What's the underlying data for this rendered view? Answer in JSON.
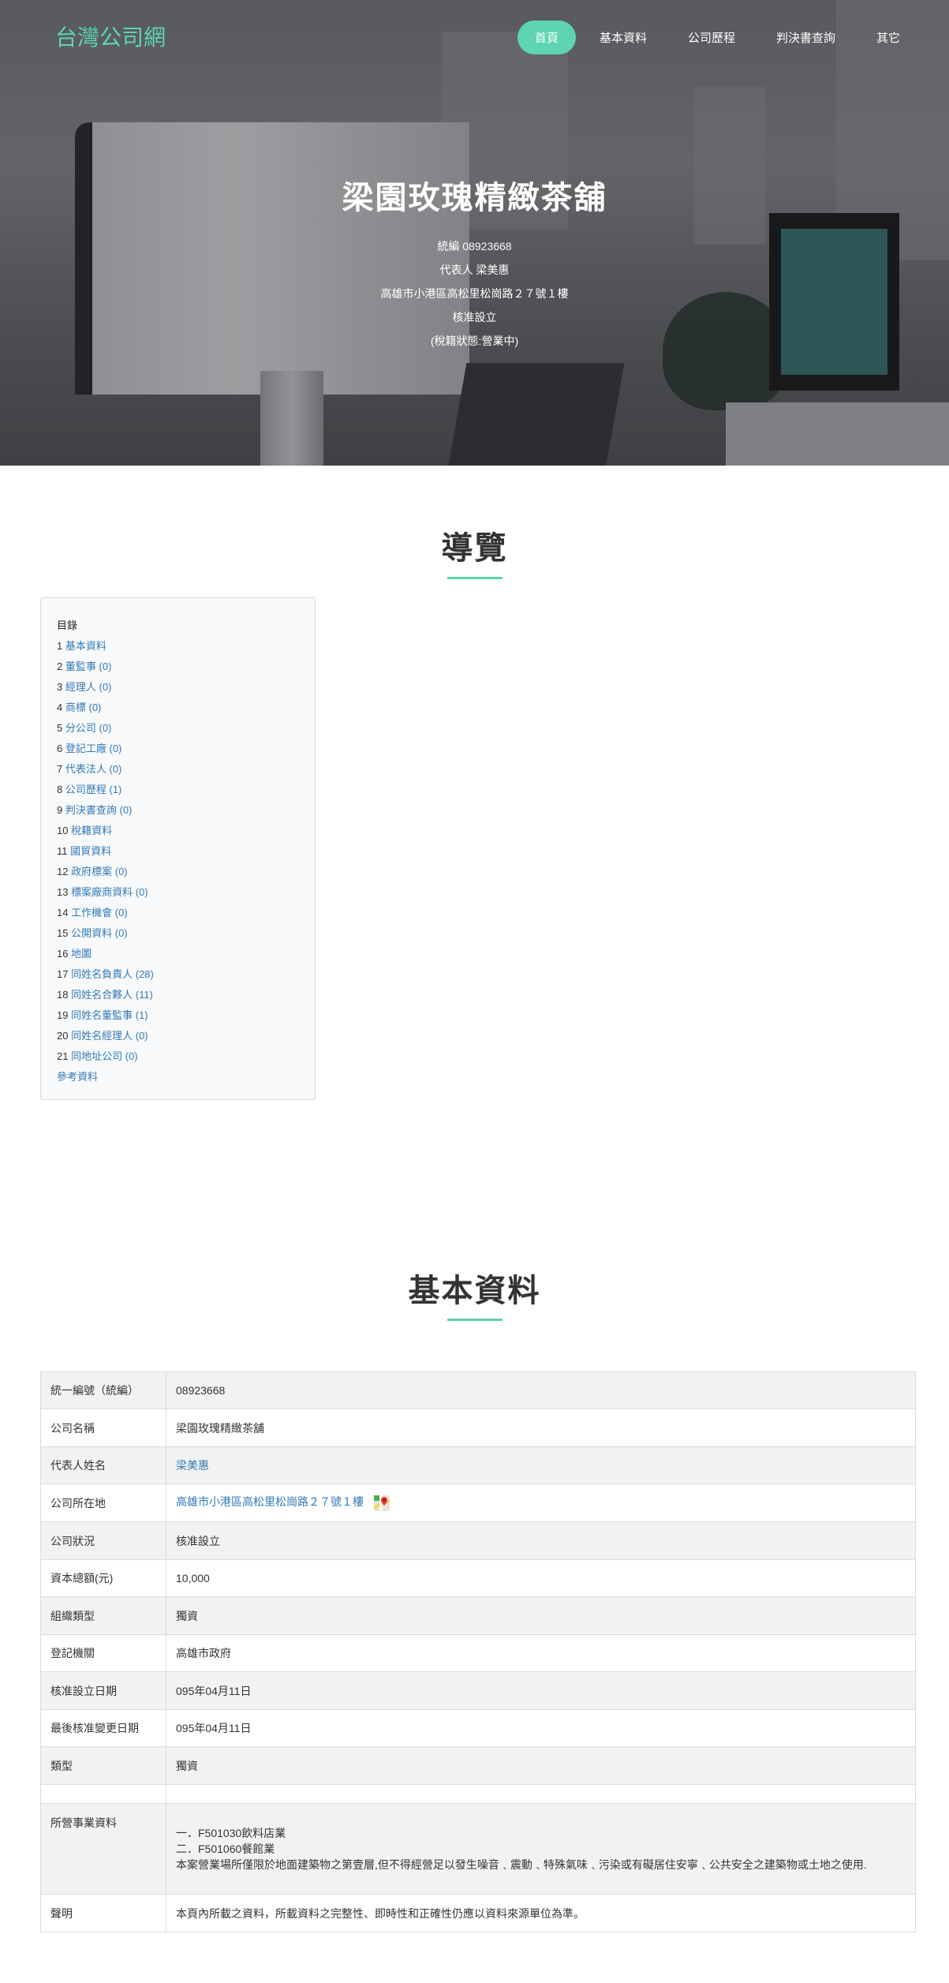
{
  "header": {
    "brand": "台灣公司網",
    "nav": [
      {
        "label": "首頁",
        "active": true
      },
      {
        "label": "基本資料",
        "active": false
      },
      {
        "label": "公司歷程",
        "active": false
      },
      {
        "label": "判決書查詢",
        "active": false
      },
      {
        "label": "其它",
        "active": false
      }
    ]
  },
  "hero": {
    "title": "梁園玫瑰精緻茶舖",
    "lines": [
      "統編 08923668",
      "代表人 梁美惠",
      "高雄市小港區高松里松崗路２７號１樓",
      "核准設立",
      "(稅籍狀態:營業中)"
    ]
  },
  "nav_section": {
    "title": "導覽",
    "toc_head": "目錄",
    "items": [
      {
        "num": "1",
        "label": "基本資料",
        "count": ""
      },
      {
        "num": "2",
        "label": "董監事",
        "count": "(0)"
      },
      {
        "num": "3",
        "label": "經理人",
        "count": "(0)"
      },
      {
        "num": "4",
        "label": "商標",
        "count": "(0)"
      },
      {
        "num": "5",
        "label": "分公司",
        "count": "(0)"
      },
      {
        "num": "6",
        "label": "登記工廠",
        "count": "(0)"
      },
      {
        "num": "7",
        "label": "代表法人",
        "count": "(0)"
      },
      {
        "num": "8",
        "label": "公司歷程",
        "count": "(1)"
      },
      {
        "num": "9",
        "label": "判決書查詢",
        "count": "(0)"
      },
      {
        "num": "10",
        "label": "稅籍資料",
        "count": ""
      },
      {
        "num": "11",
        "label": "國貿資料",
        "count": ""
      },
      {
        "num": "12",
        "label": "政府標案",
        "count": "(0)"
      },
      {
        "num": "13",
        "label": "標案廠商資料",
        "count": "(0)"
      },
      {
        "num": "14",
        "label": "工作機會",
        "count": "(0)"
      },
      {
        "num": "15",
        "label": "公開資料",
        "count": "(0)"
      },
      {
        "num": "16",
        "label": "地圖",
        "count": ""
      },
      {
        "num": "17",
        "label": "同姓名負責人",
        "count": "(28)"
      },
      {
        "num": "18",
        "label": "同姓名合夥人",
        "count": "(11)"
      },
      {
        "num": "19",
        "label": "同姓名董監事",
        "count": "(1)"
      },
      {
        "num": "20",
        "label": "同姓名經理人",
        "count": "(0)"
      },
      {
        "num": "21",
        "label": "同地址公司",
        "count": "(0)"
      }
    ],
    "reference": "參考資料"
  },
  "basic": {
    "title": "基本資料",
    "rows": [
      {
        "key": "統一編號（統編）",
        "value": "08923668"
      },
      {
        "key": "公司名稱",
        "value": "梁園玫瑰精緻茶舖"
      },
      {
        "key": "代表人姓名",
        "value": "梁美惠"
      },
      {
        "key": "公司所在地",
        "value": "高雄市小港區高松里松崗路２７號１樓"
      },
      {
        "key": "公司狀況",
        "value": "核准設立"
      },
      {
        "key": "資本總額(元)",
        "value": "10,000"
      },
      {
        "key": "組織類型",
        "value": "獨資"
      },
      {
        "key": "登記機關",
        "value": "高雄市政府"
      },
      {
        "key": "核准設立日期",
        "value": "095年04月11日"
      },
      {
        "key": "最後核准變更日期",
        "value": "095年04月11日"
      },
      {
        "key": "類型",
        "value": "獨資"
      }
    ],
    "business": {
      "key": "所營事業資料",
      "lines": [
        "一．F501030飲料店業",
        "二．F501060餐館業",
        "本案營業場所僅限於地面建築物之第壹層,但不得經營足以發生噪音﹑震動﹑特殊氣味﹑污染或有礙居住安寧﹑公共安全之建築物或土地之使用."
      ]
    },
    "statement": {
      "key": "聲明",
      "value": "本頁內所載之資料，所載資料之完整性、即時性和正確性仍應以資料來源單位為準。"
    }
  }
}
